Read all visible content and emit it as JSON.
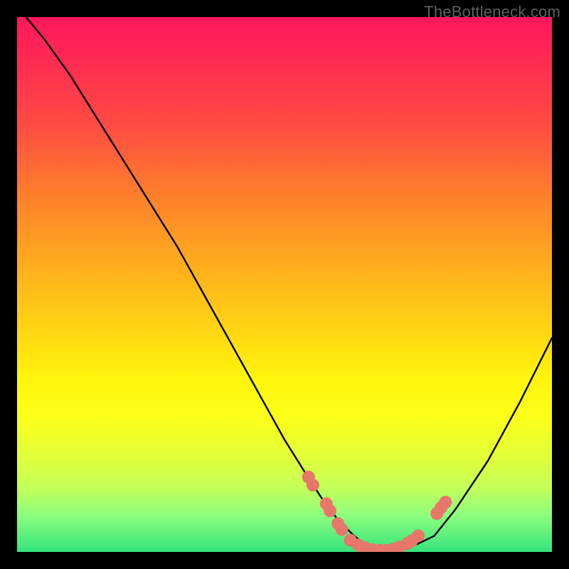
{
  "watermark": "TheBottleneck.com",
  "colors": {
    "curve_stroke": "#000000",
    "point_fill": "#e8766b",
    "point_stroke": "#e8766b"
  },
  "chart_data": {
    "type": "line",
    "title": "",
    "xlabel": "",
    "ylabel": "",
    "x": [
      0,
      5,
      10,
      15,
      20,
      25,
      30,
      35,
      40,
      45,
      50,
      55,
      57,
      60,
      63,
      65,
      68,
      70,
      73,
      78,
      82,
      88,
      94,
      100
    ],
    "values": [
      102,
      96,
      89,
      81,
      73,
      65,
      57,
      48,
      39,
      30,
      21,
      13,
      10,
      6,
      3,
      1.5,
      0.6,
      0.3,
      0.6,
      3,
      8,
      17,
      28,
      40
    ],
    "xlim": [
      0,
      100
    ],
    "ylim": [
      0,
      100
    ],
    "series": [
      {
        "name": "scatter-points",
        "type": "scatter",
        "points": [
          {
            "x": 54.5,
            "y": 14
          },
          {
            "x": 55.3,
            "y": 12.5
          },
          {
            "x": 57.8,
            "y": 9
          },
          {
            "x": 58.5,
            "y": 7.7
          },
          {
            "x": 60,
            "y": 5.3
          },
          {
            "x": 60.7,
            "y": 4.2
          },
          {
            "x": 62.3,
            "y": 2.2
          },
          {
            "x": 63.8,
            "y": 1.3
          },
          {
            "x": 65,
            "y": 0.8
          },
          {
            "x": 66.5,
            "y": 0.4
          },
          {
            "x": 67.8,
            "y": 0.3
          },
          {
            "x": 69,
            "y": 0.3
          },
          {
            "x": 70.3,
            "y": 0.5
          },
          {
            "x": 71.5,
            "y": 0.9
          },
          {
            "x": 73,
            "y": 1.6
          },
          {
            "x": 73.8,
            "y": 2.1
          },
          {
            "x": 75,
            "y": 3
          },
          {
            "x": 78.5,
            "y": 7.2
          },
          {
            "x": 79.3,
            "y": 8.3
          },
          {
            "x": 80.1,
            "y": 9.3
          }
        ]
      }
    ]
  }
}
